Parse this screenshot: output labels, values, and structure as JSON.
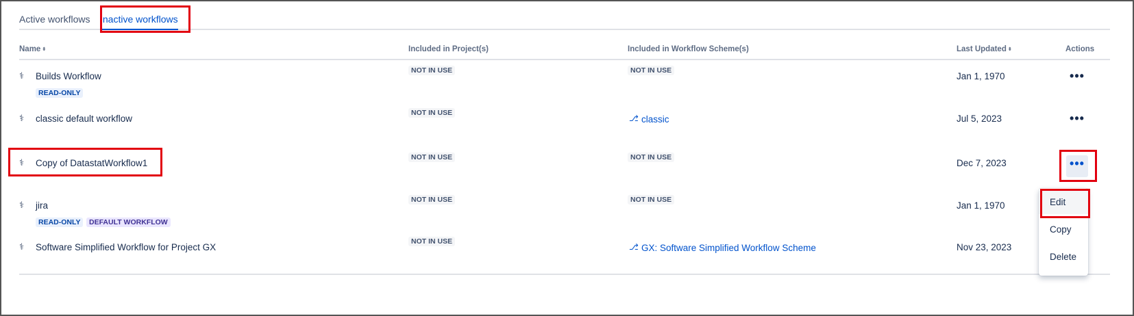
{
  "tabs": [
    {
      "label": "Active workflows"
    },
    {
      "label": "Inactive workflows"
    }
  ],
  "columns": {
    "name": "Name",
    "projects": "Included in Project(s)",
    "schemes": "Included in Workflow Scheme(s)",
    "updated": "Last Updated",
    "actions": "Actions"
  },
  "sort_glyph": "⬍",
  "workflow_icon": "workflow-icon",
  "rows": [
    {
      "name": "Builds Workflow",
      "badges": [
        "READ-ONLY"
      ],
      "projects": "NOT IN USE",
      "scheme": "NOT IN USE",
      "updated": "Jan 1, 1970"
    },
    {
      "name": "classic default workflow",
      "badges": [],
      "projects": "NOT IN USE",
      "scheme_link": "classic",
      "updated": "Jul 5, 2023"
    },
    {
      "name": "Copy of DatastatWorkflow1",
      "badges": [],
      "projects": "NOT IN USE",
      "scheme": "NOT IN USE",
      "updated": "Dec 7, 2023"
    },
    {
      "name": "jira",
      "badges": [
        "READ-ONLY",
        "DEFAULT WORKFLOW"
      ],
      "projects": "NOT IN USE",
      "scheme": "NOT IN USE",
      "updated": "Jan 1, 1970"
    },
    {
      "name": "Software Simplified Workflow for Project GX",
      "badges": [],
      "projects": "NOT IN USE",
      "scheme_link": "GX: Software Simplified Workflow Scheme",
      "updated": "Nov 23, 2023"
    }
  ],
  "actions_glyph": "•••",
  "menu": {
    "items": [
      "Edit",
      "Copy",
      "Delete"
    ]
  },
  "colors": {
    "link": "#0052cc",
    "annotation": "#e2000f"
  }
}
